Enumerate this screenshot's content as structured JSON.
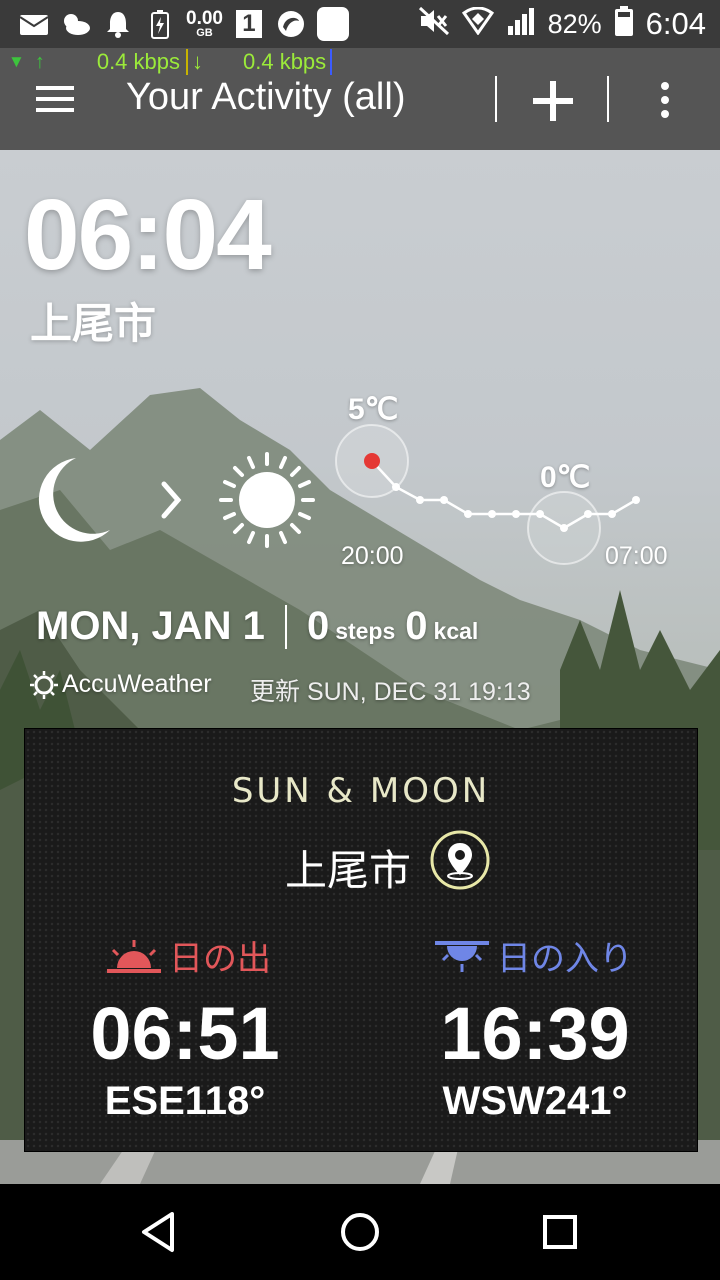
{
  "status_bar": {
    "data_usage_value": "0.00",
    "data_usage_unit": "GB",
    "sim_number": "1",
    "battery": "82%",
    "time": "6:04"
  },
  "net_speed": {
    "up": "0.4 kbps",
    "down": "0.4 kbps"
  },
  "app_bar": {
    "title": "Your Activity (all)"
  },
  "widget": {
    "clock": "06:04",
    "city": "上尾市",
    "temps": {
      "high": "5℃",
      "low": "0℃",
      "start_time": "20:00",
      "end_time": "07:00"
    },
    "date": "MON, JAN 1",
    "steps_value": "0",
    "steps_unit": "steps",
    "kcal_value": "0",
    "kcal_unit": "kcal",
    "provider": "AccuWeather",
    "updated": "更新 SUN, DEC 31 19:13"
  },
  "sun_moon": {
    "title": "SUN & MOON",
    "city": "上尾市",
    "sunrise_label": "日の出",
    "sunrise_time": "06:51",
    "sunrise_dir": "ESE118°",
    "sunset_label": "日の入り",
    "sunset_time": "16:39",
    "sunset_dir": "WSW241°"
  },
  "colors": {
    "sunrise": "#e2575a",
    "sunset": "#6f86e6",
    "net_speed": "#9bea3a",
    "temp_dot": "#e53935"
  }
}
